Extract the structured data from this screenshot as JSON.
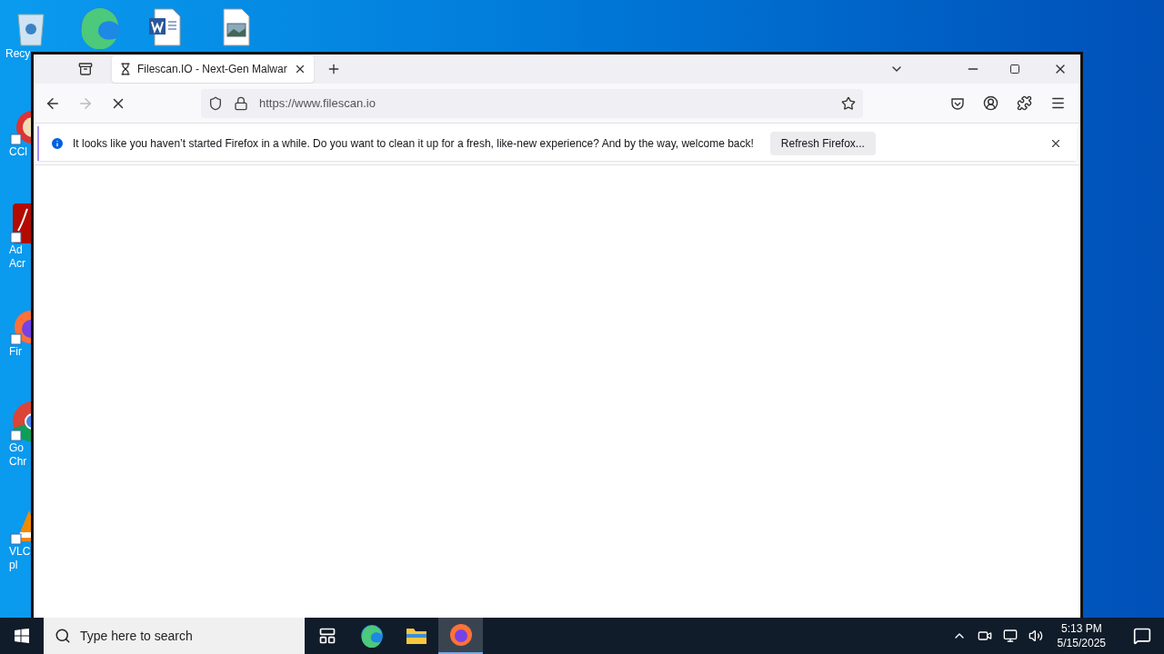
{
  "desktop_icons": [
    {
      "kind": "recycle",
      "lines": [
        "Recy"
      ]
    },
    {
      "kind": "edge"
    },
    {
      "kind": "word"
    },
    {
      "kind": "image"
    },
    {
      "kind": "ccleaner",
      "lines": [
        "CCl"
      ]
    },
    {
      "kind": "acrobat",
      "lines": [
        "Ad",
        "Acr"
      ]
    },
    {
      "kind": "firefox",
      "lines": [
        "Fir"
      ]
    },
    {
      "kind": "chrome",
      "lines": [
        "Go",
        "Chr"
      ]
    },
    {
      "kind": "vlc",
      "lines": [
        "VLC",
        "pl"
      ]
    }
  ],
  "browser": {
    "tabs": [
      {
        "title": "Filescan.IO - Next-Gen Malwar",
        "selected": true,
        "loading": true
      }
    ],
    "url": "https://www.filescan.io",
    "notification": {
      "message": "It looks like you haven’t started Firefox in a while. Do you want to clean it up for a fresh, like-new experience? And by the way, welcome back!",
      "button": "Refresh Firefox..."
    }
  },
  "taskbar": {
    "search_placeholder": "Type here to search",
    "apps": [
      {
        "kind": "taskview",
        "selected": false
      },
      {
        "kind": "edge",
        "selected": false
      },
      {
        "kind": "explorer",
        "selected": false
      },
      {
        "kind": "firefox",
        "selected": true
      }
    ],
    "time": "5:13 PM",
    "date": "5/15/2025"
  }
}
